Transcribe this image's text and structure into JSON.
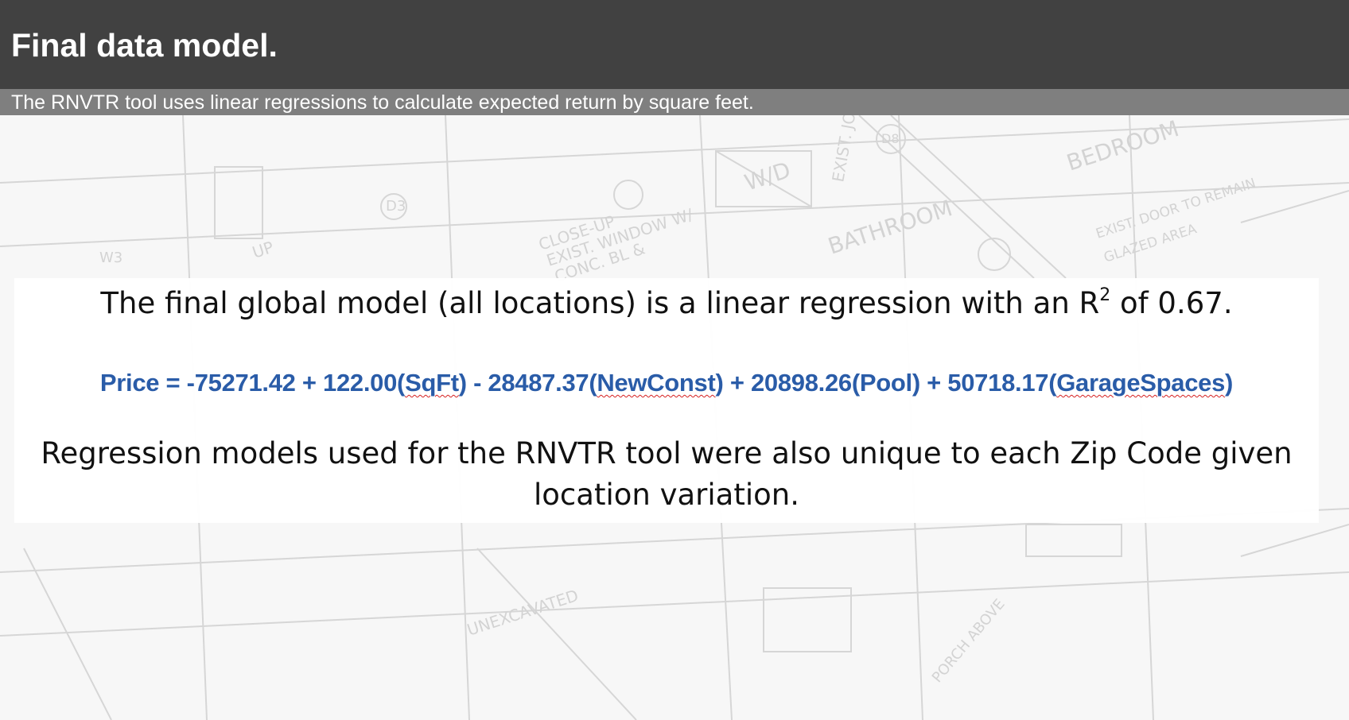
{
  "slide": {
    "title": "Final data model.",
    "subtitle": "The RNVTR tool uses linear regressions to calculate expected return by square feet."
  },
  "model_summary": {
    "prefix": "The final global model (all locations) is a linear regression with an R",
    "superscript": "2",
    "suffix": " of 0.67."
  },
  "equation": {
    "start": "Price = -75271.42 + 122.00(",
    "var1": "SqFt",
    "part2": ") - 28487.37(",
    "var2": "NewConst",
    "part3": ") + 20898.26(Pool) + 50718.17(",
    "var3": "GarageSpaces",
    "end": ")"
  },
  "note": "Regression models used for the RNVTR tool were also unique to each Zip Code given location variation.",
  "background": {
    "labels": [
      "BEDROOM",
      "BATHROOM",
      "W/D",
      "CLOSE-UP",
      "EXIST. WINDOW W/",
      "CONC. BL &",
      "UP",
      "W3",
      "D3",
      "D8",
      "EXIST. JOISTS",
      "UNEXCAVATED",
      "PORCH ABOVE",
      "EXIST. DOOR TO REMAIN",
      "GLAZED AREA"
    ]
  },
  "colors": {
    "title_bar": "#414141",
    "subtitle_bar": "#7f7f7f",
    "equation": "#2a5ca8"
  }
}
